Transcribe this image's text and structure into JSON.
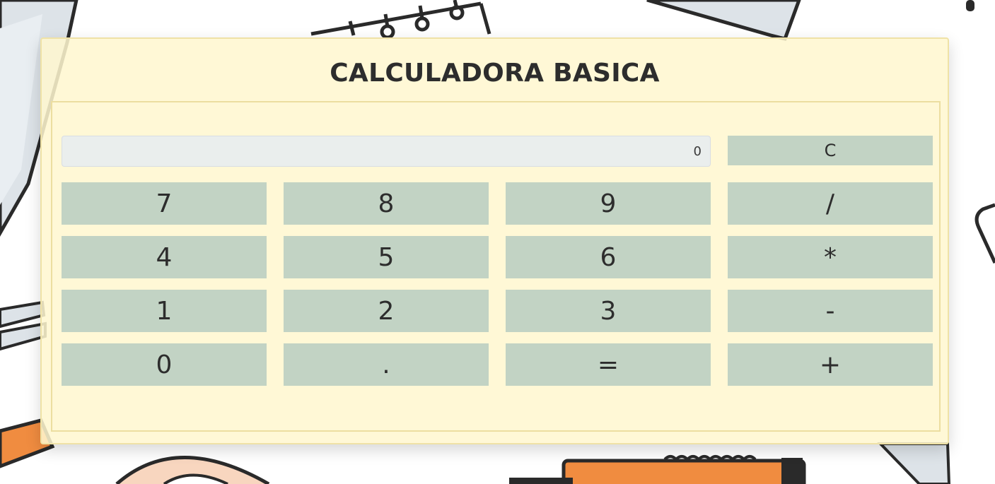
{
  "calculator": {
    "title": "CALCULADORA BASICA",
    "display_value": "0",
    "clear_label": "C",
    "keys": [
      [
        "7",
        "8",
        "9",
        "/"
      ],
      [
        "4",
        "5",
        "6",
        "*"
      ],
      [
        "1",
        "2",
        "3",
        "-"
      ],
      [
        "0",
        ".",
        "=",
        "+"
      ]
    ]
  },
  "colors": {
    "card_background": "#fff7cf",
    "button_background": "#c0d2c3",
    "display_background": "#e8ecf0",
    "title_text": "#2d2d2d"
  }
}
